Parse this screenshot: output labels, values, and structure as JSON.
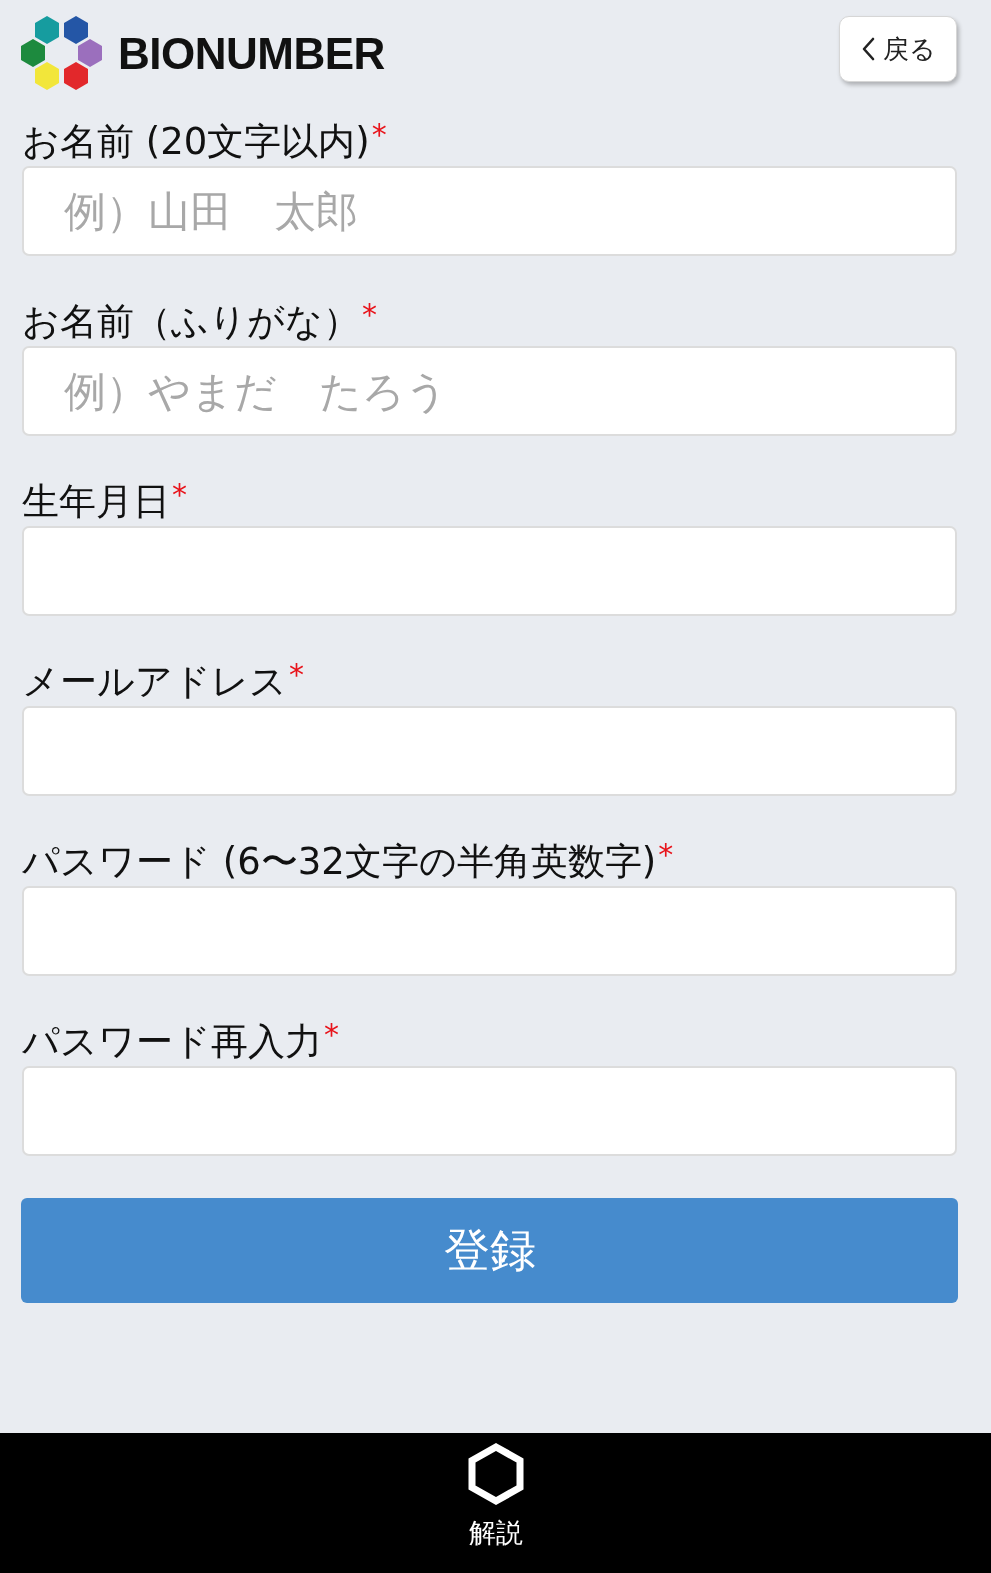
{
  "header": {
    "title": "BIONUMBER",
    "back_button": {
      "label": "戻る"
    }
  },
  "fields": [
    {
      "label": "お名前 (20文字以内)",
      "required_mark": "*",
      "placeholder": "例）山田　太郎"
    },
    {
      "label": "お名前（ふりがな）",
      "required_mark": "*",
      "placeholder": "例）やまだ　たろう"
    },
    {
      "label": "生年月日",
      "required_mark": "*"
    },
    {
      "label": "メールアドレス",
      "required_mark": "*"
    },
    {
      "label": "パスワード (6〜32文字の半角英数字)",
      "required_mark": "*"
    },
    {
      "label": "パスワード再入力",
      "required_mark": "*"
    }
  ],
  "submit_button": {
    "label": "登録"
  },
  "bottom_bar": {
    "items": [
      {
        "label": "解説"
      }
    ]
  }
}
